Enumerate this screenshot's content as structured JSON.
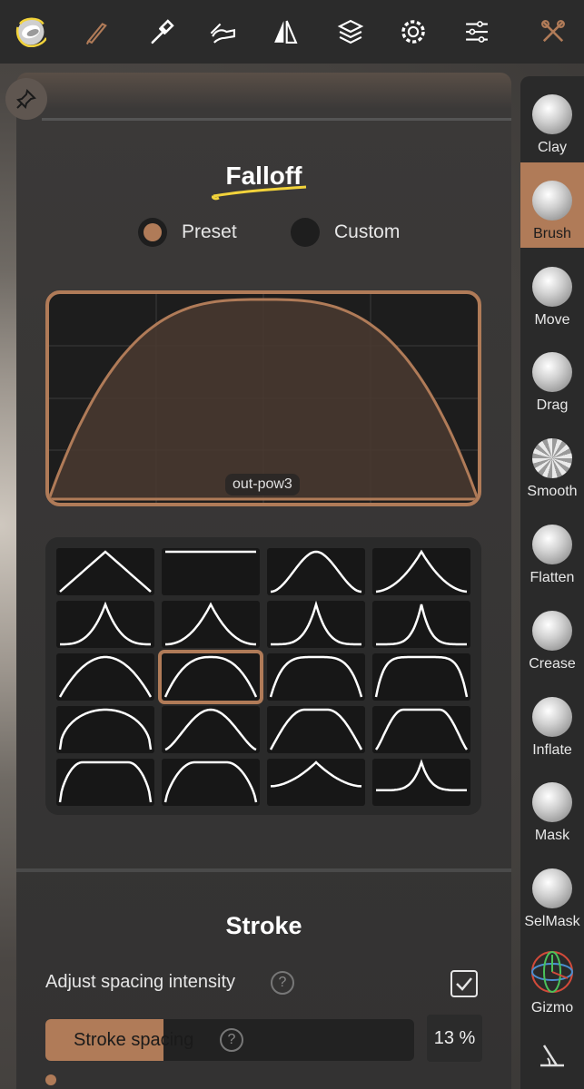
{
  "toolbar": {
    "icons": [
      "brush-sphere-icon",
      "paint-brush-icon",
      "eyedropper-icon",
      "hand-stroke-icon",
      "symmetry-icon",
      "layers-icon",
      "settings-gear-icon",
      "sliders-menu-icon",
      "tools-wrench-icon"
    ]
  },
  "falloff": {
    "title": "Falloff",
    "mode_options": [
      "Preset",
      "Custom"
    ],
    "selected_mode": "Preset",
    "curve_name": "out-pow3"
  },
  "stroke": {
    "title": "Stroke",
    "adjust_spacing_label": "Adjust spacing intensity",
    "adjust_spacing_checked": true,
    "spacing_label": "Stroke spacing",
    "spacing_value": "13 %",
    "spacing_fraction": 0.32
  },
  "tools": [
    {
      "label": "Clay"
    },
    {
      "label": "Brush"
    },
    {
      "label": "Move"
    },
    {
      "label": "Drag"
    },
    {
      "label": "Smooth"
    },
    {
      "label": "Flatten"
    },
    {
      "label": "Crease"
    },
    {
      "label": "Inflate"
    },
    {
      "label": "Mask"
    },
    {
      "label": "SelMask"
    },
    {
      "label": "Gizmo"
    }
  ],
  "active_tool": "Brush",
  "colors": {
    "accent": "#b07b58",
    "highlight_annotation": "#f2d33b"
  }
}
